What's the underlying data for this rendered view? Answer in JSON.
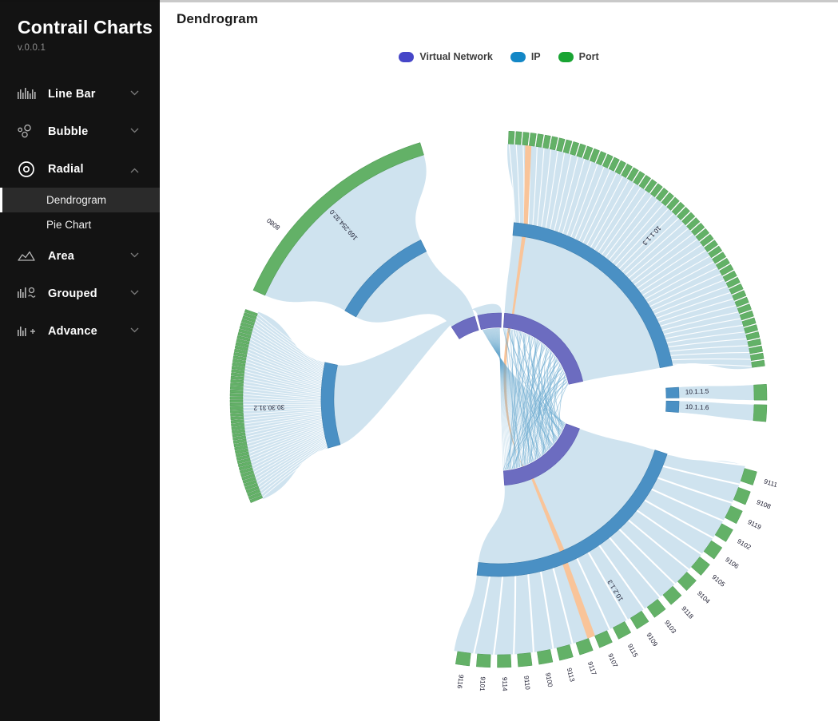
{
  "app": {
    "brand_title": "Contrail Charts",
    "version": "v.0.0.1"
  },
  "sidebar": {
    "items": [
      {
        "label": "Line Bar",
        "icon": "bar-chart-icon",
        "chevron": "chevron-down-icon",
        "expanded": false
      },
      {
        "label": "Bubble",
        "icon": "bubble-icon",
        "chevron": "chevron-down-icon",
        "expanded": false
      },
      {
        "label": "Radial",
        "icon": "radial-icon",
        "chevron": "chevron-up-icon",
        "expanded": true,
        "children": [
          {
            "label": "Dendrogram",
            "selected": true
          },
          {
            "label": "Pie Chart",
            "selected": false
          }
        ]
      },
      {
        "label": "Area",
        "icon": "area-chart-icon",
        "chevron": "chevron-down-icon",
        "expanded": false
      },
      {
        "label": "Grouped",
        "icon": "grouped-chart-icon",
        "chevron": "chevron-down-icon",
        "expanded": false
      },
      {
        "label": "Advance",
        "icon": "advance-chart-icon",
        "chevron": "chevron-down-icon",
        "expanded": false
      }
    ]
  },
  "header": {
    "title": "Dendrogram"
  },
  "legend": {
    "items": [
      {
        "label": "Virtual Network",
        "color": "#4646c8"
      },
      {
        "label": "IP",
        "color": "#1387c6"
      },
      {
        "label": "Port",
        "color": "#19a433"
      }
    ]
  },
  "chart_data": {
    "type": "radial-dendrogram",
    "title": "Dendrogram",
    "colors": {
      "virtual_network": "#6c6cc0",
      "ip": "#4a90c4",
      "port": "#63b167",
      "ribbon": "#cfe3ef",
      "ribbon_highlight": "#f9c499",
      "link": "#6aa9cf",
      "background": "#ffffff"
    },
    "rings": [
      {
        "name": "virtual-network",
        "level": 0,
        "color": "#6c6cc0"
      },
      {
        "name": "ip",
        "level": 1,
        "color": "#4a90c4"
      },
      {
        "name": "port",
        "level": 2,
        "color": "#63b167"
      }
    ],
    "groups": [
      {
        "id": "g-8080",
        "ip_label": "169.254.32.0",
        "port_labels": [
          "8080"
        ],
        "start_angle": -66,
        "end_angle": -17,
        "ip_start": -60,
        "ip_end": -26,
        "vn_start": -33,
        "vn_end": -16,
        "port_segments": 1
      },
      {
        "id": "g-30-30-31-2",
        "ip_label": "30.30.31.2",
        "port_labels": [],
        "start_angle": -113,
        "end_angle": -70,
        "ip_start": -106,
        "ip_end": -78,
        "vn_start": -14,
        "vn_end": 2,
        "port_segments": 58
      },
      {
        "id": "g-10-1-1-3",
        "ip_label": "10.1.1.3",
        "port_labels": [],
        "start_angle": 2,
        "end_angle": 83,
        "ip_start": 5,
        "ip_end": 79,
        "vn_start": 4,
        "vn_end": 78,
        "port_segments": 52
      },
      {
        "id": "g-10-1-1-5",
        "ip_label": "10.1.1.5",
        "port_labels": [],
        "start_angle": 86,
        "end_angle": 90,
        "port_segments": 1
      },
      {
        "id": "g-10-1-1-6",
        "ip_label": "10.1.1.6",
        "port_labels": [],
        "start_angle": 91,
        "end_angle": 95,
        "port_segments": 1
      },
      {
        "id": "g-10-2-1-3",
        "ip_label": "10.2.1.3",
        "port_labels": [
          "9111",
          "9108",
          "9119",
          "9102",
          "9106",
          "9105",
          "9104",
          "9118",
          "9103",
          "9109",
          "9115",
          "9107",
          "9117",
          "9113",
          "9100",
          "9110",
          "9114",
          "9101",
          "9116"
        ],
        "start_angle": 105,
        "end_angle": 190,
        "ip_start": 108,
        "ip_end": 187,
        "vn_start": 110,
        "vn_end": 176,
        "port_segments": 19
      }
    ],
    "ip_labels": [
      "169.254.32.0",
      "30.30.31.2",
      "10.1.1.3",
      "10.1.1.5",
      "10.1.1.6",
      "10.2.1.3"
    ],
    "port_labels_visible": [
      "8080",
      "9111",
      "9108",
      "9119",
      "9102",
      "9106",
      "9105",
      "9104",
      "9118",
      "9103",
      "9109",
      "9115",
      "9107",
      "9117",
      "9113",
      "9100",
      "9110",
      "9114",
      "9101",
      "9116"
    ],
    "highlighted_path": {
      "port": "9113",
      "color": "#f9c499"
    }
  }
}
